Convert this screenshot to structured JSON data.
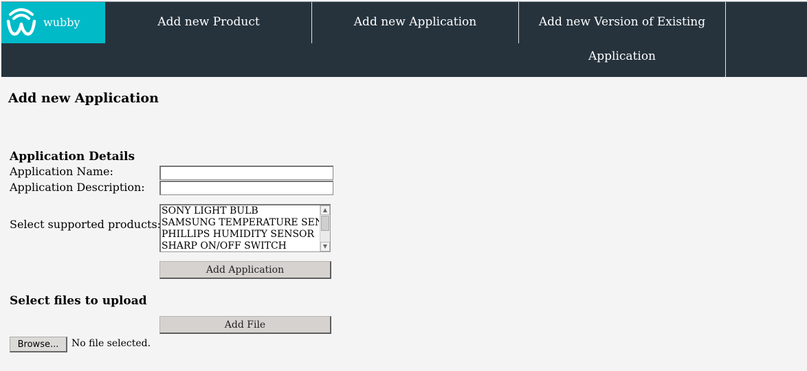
{
  "nav": {
    "brand_name": "wubby",
    "links": [
      "Add new Product",
      "Add new Application",
      "Add new Version of Existing",
      "Application"
    ]
  },
  "page": {
    "title": "Add new Application"
  },
  "details": {
    "heading": "Application Details",
    "name_label": "Application Name:",
    "name_value": "",
    "description_label": "Application Description:",
    "description_value": "",
    "products_label": "Select supported products:",
    "products": [
      "SONY LIGHT BULB",
      "SAMSUNG TEMPERATURE SENSOR",
      "PHILLIPS HUMIDITY SENSOR",
      "SHARP ON/OFF SWITCH"
    ],
    "add_button": "Add Application"
  },
  "upload": {
    "heading": "Select files to upload",
    "add_file_button": "Add File",
    "browse_button": "Browse...",
    "status": "No file selected."
  },
  "colors": {
    "nav_bg": "#26333d",
    "brand_bg": "#00bac8",
    "page_bg": "#f4f4f4"
  }
}
